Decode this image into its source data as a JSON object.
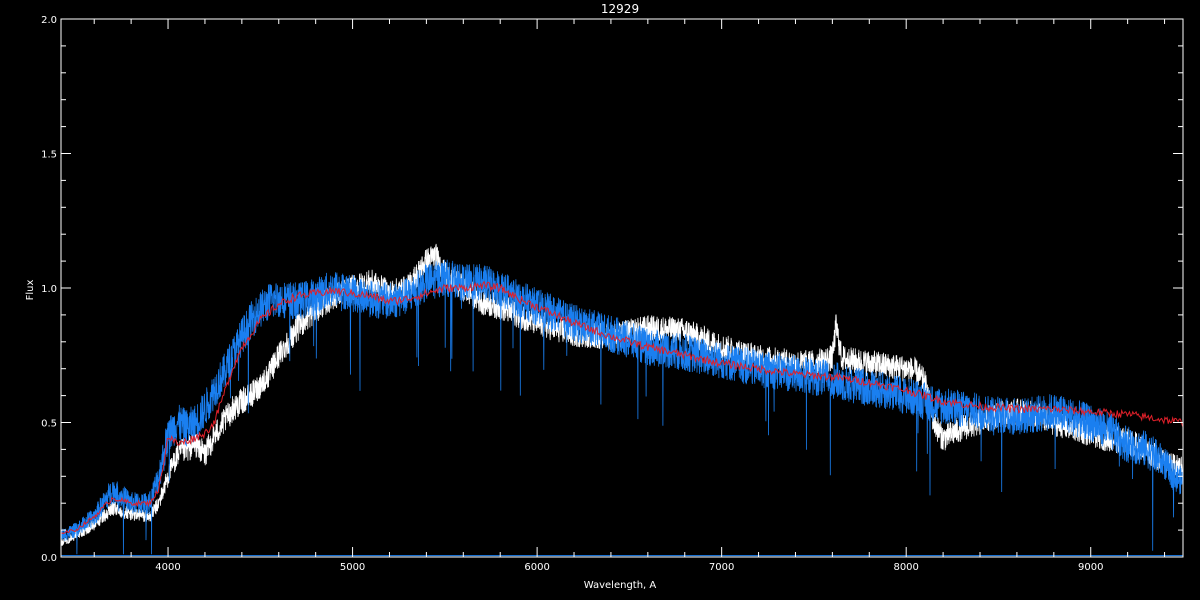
{
  "chart_data": {
    "type": "line",
    "title": "12929",
    "xlabel": "Wavelength, A",
    "ylabel": "Flux",
    "xlim": [
      3420,
      9500
    ],
    "ylim": [
      0.0,
      2.0
    ],
    "x_ticks": [
      4000,
      5000,
      6000,
      7000,
      8000,
      9000
    ],
    "x_tick_labels": [
      "4000",
      "5000",
      "6000",
      "7000",
      "8000",
      "9000"
    ],
    "y_ticks": [
      0.0,
      0.5,
      1.0,
      1.5,
      2.0
    ],
    "y_tick_labels": [
      "0.0",
      "0.5",
      "1.0",
      "1.5",
      "2.0"
    ],
    "grid": false,
    "background": "#000000",
    "axis_color": "#ffffff",
    "series": [
      {
        "color": "#ffffff",
        "noise": 0.05,
        "x": [
          3420,
          3500,
          3600,
          3700,
          3800,
          3900,
          3950,
          4000,
          4050,
          4100,
          4150,
          4200,
          4250,
          4300,
          4350,
          4400,
          4450,
          4500,
          4550,
          4600,
          4700,
          4800,
          4900,
          5000,
          5100,
          5200,
          5300,
          5400,
          5450,
          5500,
          5600,
          5700,
          5800,
          5900,
          6000,
          6100,
          6200,
          6400,
          6600,
          6800,
          7000,
          7200,
          7400,
          7500,
          7600,
          7620,
          7650,
          7700,
          7800,
          7900,
          8000,
          8050,
          8100,
          8150,
          8200,
          8300,
          8400,
          8500,
          8600,
          8700,
          8800,
          8900,
          9000,
          9100,
          9200,
          9300,
          9400,
          9500
        ],
        "y": [
          0.05,
          0.08,
          0.12,
          0.18,
          0.16,
          0.15,
          0.2,
          0.3,
          0.38,
          0.4,
          0.42,
          0.38,
          0.45,
          0.5,
          0.55,
          0.58,
          0.6,
          0.64,
          0.68,
          0.75,
          0.85,
          0.92,
          0.97,
          1.0,
          1.02,
          0.98,
          1.0,
          1.1,
          1.12,
          1.05,
          1.0,
          0.95,
          0.93,
          0.9,
          0.87,
          0.85,
          0.83,
          0.82,
          0.85,
          0.84,
          0.78,
          0.74,
          0.72,
          0.72,
          0.74,
          0.86,
          0.74,
          0.73,
          0.72,
          0.71,
          0.7,
          0.69,
          0.65,
          0.5,
          0.44,
          0.48,
          0.5,
          0.53,
          0.54,
          0.53,
          0.5,
          0.48,
          0.46,
          0.44,
          0.43,
          0.4,
          0.35,
          0.33
        ]
      },
      {
        "color": "#1a7ff0",
        "noise": 0.07,
        "x": [
          3420,
          3500,
          3600,
          3700,
          3800,
          3900,
          3950,
          4000,
          4050,
          4100,
          4150,
          4200,
          4250,
          4300,
          4350,
          4400,
          4450,
          4500,
          4550,
          4600,
          4700,
          4800,
          4900,
          5000,
          5100,
          5200,
          5300,
          5400,
          5500,
          5600,
          5700,
          5800,
          5900,
          6000,
          6100,
          6200,
          6400,
          6600,
          6800,
          7000,
          7200,
          7400,
          7600,
          7700,
          7800,
          8000,
          8200,
          8400,
          8500,
          8600,
          8700,
          8800,
          8900,
          9000,
          9100,
          9200,
          9300,
          9400,
          9450,
          9500
        ],
        "y": [
          0.08,
          0.1,
          0.15,
          0.25,
          0.2,
          0.2,
          0.3,
          0.45,
          0.5,
          0.48,
          0.5,
          0.55,
          0.62,
          0.68,
          0.75,
          0.82,
          0.88,
          0.92,
          0.95,
          0.96,
          0.95,
          0.97,
          1.0,
          0.98,
          0.96,
          0.95,
          0.97,
          1.02,
          1.04,
          1.02,
          1.02,
          1.0,
          0.96,
          0.93,
          0.9,
          0.87,
          0.83,
          0.78,
          0.76,
          0.73,
          0.7,
          0.68,
          0.66,
          0.64,
          0.63,
          0.6,
          0.56,
          0.54,
          0.53,
          0.52,
          0.53,
          0.54,
          0.52,
          0.5,
          0.47,
          0.42,
          0.4,
          0.35,
          0.3,
          0.28
        ]
      },
      {
        "color": "#e0202a",
        "noise": 0.015,
        "x": [
          3420,
          3500,
          3600,
          3700,
          3800,
          3900,
          3950,
          4000,
          4050,
          4100,
          4200,
          4250,
          4300,
          4350,
          4400,
          4500,
          4600,
          4700,
          4800,
          4900,
          5000,
          5100,
          5200,
          5300,
          5400,
          5500,
          5600,
          5700,
          5800,
          5900,
          6000,
          6100,
          6200,
          6400,
          6600,
          6800,
          7000,
          7200,
          7400,
          7600,
          7800,
          8000,
          8100,
          8200,
          8400,
          8600,
          8800,
          9000,
          9200,
          9400,
          9500
        ],
        "y": [
          0.09,
          0.1,
          0.15,
          0.22,
          0.2,
          0.2,
          0.25,
          0.45,
          0.42,
          0.43,
          0.46,
          0.5,
          0.6,
          0.7,
          0.78,
          0.88,
          0.94,
          0.97,
          0.98,
          0.99,
          0.98,
          0.97,
          0.95,
          0.96,
          0.98,
          1.0,
          1.0,
          1.01,
          1.0,
          0.96,
          0.93,
          0.9,
          0.87,
          0.82,
          0.78,
          0.75,
          0.72,
          0.7,
          0.68,
          0.67,
          0.65,
          0.62,
          0.6,
          0.58,
          0.56,
          0.55,
          0.55,
          0.54,
          0.53,
          0.51,
          0.5
        ]
      }
    ]
  }
}
